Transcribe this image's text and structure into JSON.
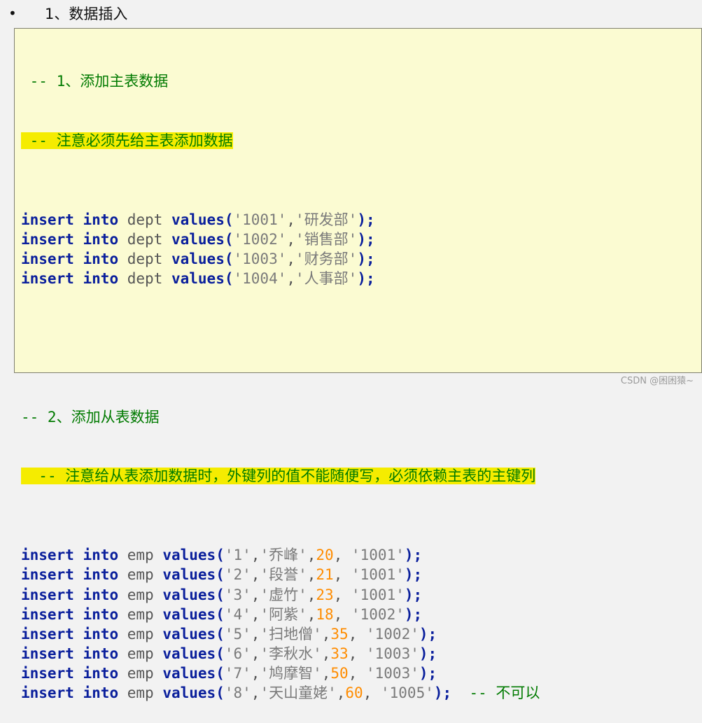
{
  "heading": {
    "bullet": "•",
    "text": "1、数据插入"
  },
  "code": {
    "comment1": "-- 1、添加主表数据",
    "comment2": "-- 注意必须先给主表添加数据",
    "comment3": "-- 2、添加从表数据",
    "comment4": "-- 注意给从表添加数据时，外键列的值不能随便写，必须依赖主表的主键列",
    "trailing_comment": "-- 不可以",
    "kw_insert": "insert",
    "kw_into": "into",
    "kw_values": "values",
    "dept_rows": [
      {
        "table": "dept",
        "id": "'1001'",
        "name": "'研发部'"
      },
      {
        "table": "dept",
        "id": "'1002'",
        "name": "'销售部'"
      },
      {
        "table": "dept",
        "id": "'1003'",
        "name": "'财务部'"
      },
      {
        "table": "dept",
        "id": "'1004'",
        "name": "'人事部'"
      }
    ],
    "emp_rows": [
      {
        "table": "emp",
        "id": "'1'",
        "name": "'乔峰'",
        "age": "20",
        "dept": "'1001'"
      },
      {
        "table": "emp",
        "id": "'2'",
        "name": "'段誉'",
        "age": "21",
        "dept": "'1001'"
      },
      {
        "table": "emp",
        "id": "'3'",
        "name": "'虚竹'",
        "age": "23",
        "dept": "'1001'"
      },
      {
        "table": "emp",
        "id": "'4'",
        "name": "'阿紫'",
        "age": "18",
        "dept": "'1002'"
      },
      {
        "table": "emp",
        "id": "'5'",
        "name": "'扫地僧'",
        "age": "35",
        "dept": "'1002'"
      },
      {
        "table": "emp",
        "id": "'6'",
        "name": "'李秋水'",
        "age": "33",
        "dept": "'1003'"
      },
      {
        "table": "emp",
        "id": "'7'",
        "name": "'鸠摩智'",
        "age": "50",
        "dept": "'1003'"
      },
      {
        "table": "emp",
        "id": "'8'",
        "name": "'天山童姥'",
        "age": "60",
        "dept": "'1005'"
      }
    ]
  },
  "watermark": "CSDN @困困猿~"
}
